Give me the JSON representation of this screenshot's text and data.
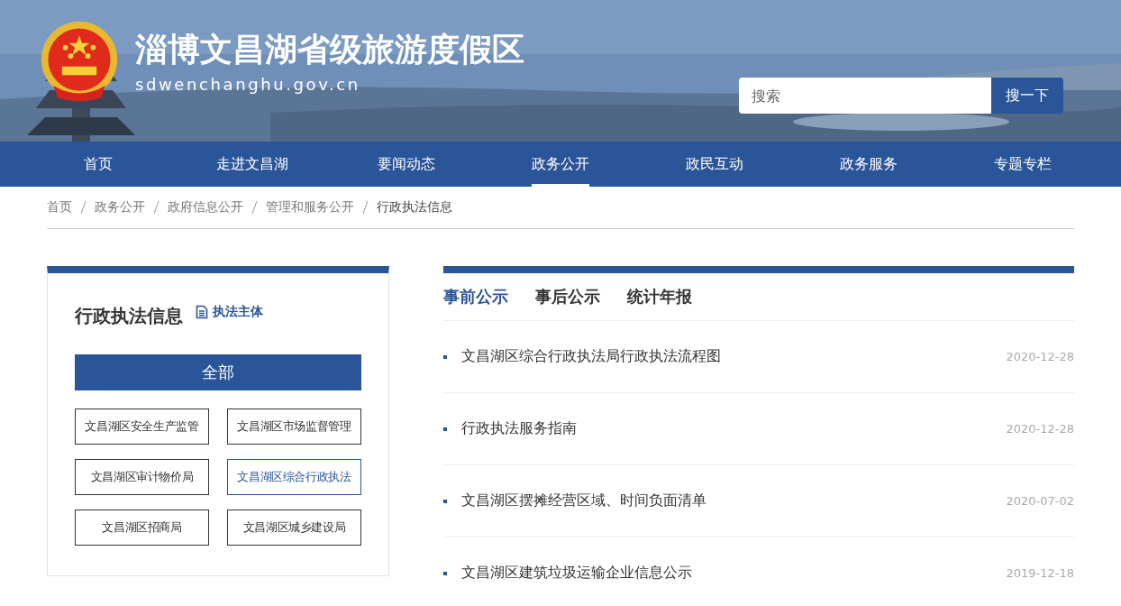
{
  "header": {
    "title": "淄博文昌湖省级旅游度假区",
    "domain": "sdwenchanghu.gov.cn",
    "search": {
      "placeholder": "搜索",
      "button": "搜一下"
    }
  },
  "nav": [
    {
      "label": "首页",
      "selected": false
    },
    {
      "label": "走进文昌湖",
      "selected": false
    },
    {
      "label": "要闻动态",
      "selected": false
    },
    {
      "label": "政务公开",
      "selected": true
    },
    {
      "label": "政民互动",
      "selected": false
    },
    {
      "label": "政务服务",
      "selected": false
    },
    {
      "label": "专题专栏",
      "selected": false
    }
  ],
  "breadcrumb": [
    "首页",
    "政务公开",
    "政府信息公开",
    "管理和服务公开",
    "行政执法信息"
  ],
  "sidebar": {
    "title": "行政执法信息",
    "link": "执法主体",
    "all": {
      "label": "全部",
      "selected": true
    },
    "categories": [
      {
        "label": "文昌湖区安全生产监管",
        "selected": false
      },
      {
        "label": "文昌湖区市场监督管理",
        "selected": false
      },
      {
        "label": "文昌湖区审计物价局",
        "selected": false
      },
      {
        "label": "文昌湖区综合行政执法",
        "selected": true
      },
      {
        "label": "文昌湖区招商局",
        "selected": false
      },
      {
        "label": "文昌湖区城乡建设局",
        "selected": false
      }
    ]
  },
  "tabs": [
    {
      "label": "事前公示",
      "selected": true
    },
    {
      "label": "事后公示",
      "selected": false
    },
    {
      "label": "统计年报",
      "selected": false
    }
  ],
  "articles": [
    {
      "title": "文昌湖区综合行政执法局行政执法流程图",
      "date": "2020-12-28"
    },
    {
      "title": "行政执法服务指南",
      "date": "2020-12-28"
    },
    {
      "title": "文昌湖区摆摊经营区域、时间负面清单",
      "date": "2020-07-02"
    },
    {
      "title": "文昌湖区建筑垃圾运输企业信息公示",
      "date": "2019-12-18"
    }
  ]
}
